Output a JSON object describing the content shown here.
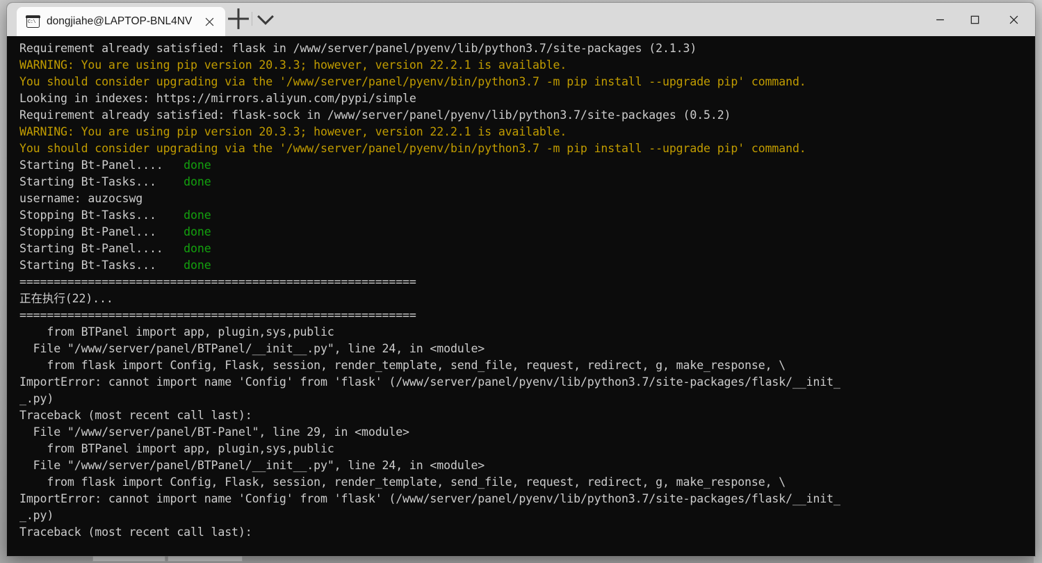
{
  "window": {
    "app": "Windows Terminal",
    "controls": {
      "minimize_label": "Minimize",
      "maximize_label": "Maximize",
      "close_label": "Close"
    }
  },
  "tabbar": {
    "tab": {
      "icon": "command-prompt-icon",
      "title": "dongjiahe@LAPTOP-BNL4NV",
      "close_label": "Close tab"
    },
    "new_tab_label": "+",
    "dropdown_label": "v"
  },
  "terminal": {
    "colors": {
      "background": "#0c0c0c",
      "foreground": "#cccccc",
      "yellow": "#c19c00",
      "green": "#13a10e"
    },
    "lines": [
      {
        "text": "Requirement already satisfied: flask in /www/server/panel/pyenv/lib/python3.7/site-packages (2.1.3)",
        "color": "white"
      },
      {
        "text": "WARNING: You are using pip version 20.3.3; however, version 22.2.1 is available.",
        "color": "yellow"
      },
      {
        "text": "You should consider upgrading via the '/www/server/panel/pyenv/bin/python3.7 -m pip install --upgrade pip' command.",
        "color": "yellow"
      },
      {
        "text": "Looking in indexes: https://mirrors.aliyun.com/pypi/simple",
        "color": "white"
      },
      {
        "text": "Requirement already satisfied: flask-sock in /www/server/panel/pyenv/lib/python3.7/site-packages (0.5.2)",
        "color": "white"
      },
      {
        "text": "WARNING: You are using pip version 20.3.3; however, version 22.2.1 is available.",
        "color": "yellow"
      },
      {
        "text": "You should consider upgrading via the '/www/server/panel/pyenv/bin/python3.7 -m pip install --upgrade pip' command.",
        "color": "yellow"
      },
      {
        "text": "Starting Bt-Panel....   ",
        "color": "white",
        "suffix": "done",
        "suffix_color": "green"
      },
      {
        "text": "Starting Bt-Tasks...    ",
        "color": "white",
        "suffix": "done",
        "suffix_color": "green"
      },
      {
        "text": "username: auzocswg",
        "color": "white"
      },
      {
        "text": "Stopping Bt-Tasks...    ",
        "color": "white",
        "suffix": "done",
        "suffix_color": "green"
      },
      {
        "text": "Stopping Bt-Panel...    ",
        "color": "white",
        "suffix": "done",
        "suffix_color": "green"
      },
      {
        "text": "Starting Bt-Panel....   ",
        "color": "white",
        "suffix": "done",
        "suffix_color": "green"
      },
      {
        "text": "Starting Bt-Tasks...    ",
        "color": "white",
        "suffix": "done",
        "suffix_color": "green"
      },
      {
        "text": "==========================================================",
        "color": "white"
      },
      {
        "text": "正在执行(22)...",
        "color": "white"
      },
      {
        "text": "==========================================================",
        "color": "white"
      },
      {
        "text": "    from BTPanel import app, plugin,sys,public",
        "color": "white"
      },
      {
        "text": "  File \"/www/server/panel/BTPanel/__init__.py\", line 24, in <module>",
        "color": "white"
      },
      {
        "text": "    from flask import Config, Flask, session, render_template, send_file, request, redirect, g, make_response, \\",
        "color": "white"
      },
      {
        "text": "ImportError: cannot import name 'Config' from 'flask' (/www/server/panel/pyenv/lib/python3.7/site-packages/flask/__init_",
        "color": "white"
      },
      {
        "text": "_.py)",
        "color": "white"
      },
      {
        "text": "Traceback (most recent call last):",
        "color": "white"
      },
      {
        "text": "  File \"/www/server/panel/BT-Panel\", line 29, in <module>",
        "color": "white"
      },
      {
        "text": "    from BTPanel import app, plugin,sys,public",
        "color": "white"
      },
      {
        "text": "  File \"/www/server/panel/BTPanel/__init__.py\", line 24, in <module>",
        "color": "white"
      },
      {
        "text": "    from flask import Config, Flask, session, render_template, send_file, request, redirect, g, make_response, \\",
        "color": "white"
      },
      {
        "text": "ImportError: cannot import name 'Config' from 'flask' (/www/server/panel/pyenv/lib/python3.7/site-packages/flask/__init_",
        "color": "white"
      },
      {
        "text": "_.py)",
        "color": "white"
      },
      {
        "text": "Traceback (most recent call last):",
        "color": "white"
      }
    ]
  }
}
